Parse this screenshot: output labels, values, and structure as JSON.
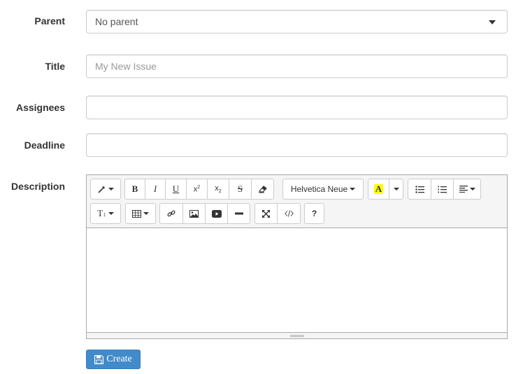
{
  "fields": {
    "parent": {
      "label": "Parent",
      "value": "No parent"
    },
    "title": {
      "label": "Title",
      "placeholder": "My New Issue"
    },
    "assignees": {
      "label": "Assignees",
      "value": ""
    },
    "deadline": {
      "label": "Deadline",
      "value": ""
    },
    "description": {
      "label": "Description"
    }
  },
  "toolbar": {
    "font_name": "Helvetica Neue",
    "bold": "B",
    "italic": "I",
    "underline": "U",
    "strike": "S",
    "help": "?",
    "highlight_letter": "A",
    "highlight_color": "#ffff00",
    "text_size": "T"
  },
  "actions": {
    "create_label": "Create"
  },
  "colors": {
    "primary": "#428bca"
  }
}
